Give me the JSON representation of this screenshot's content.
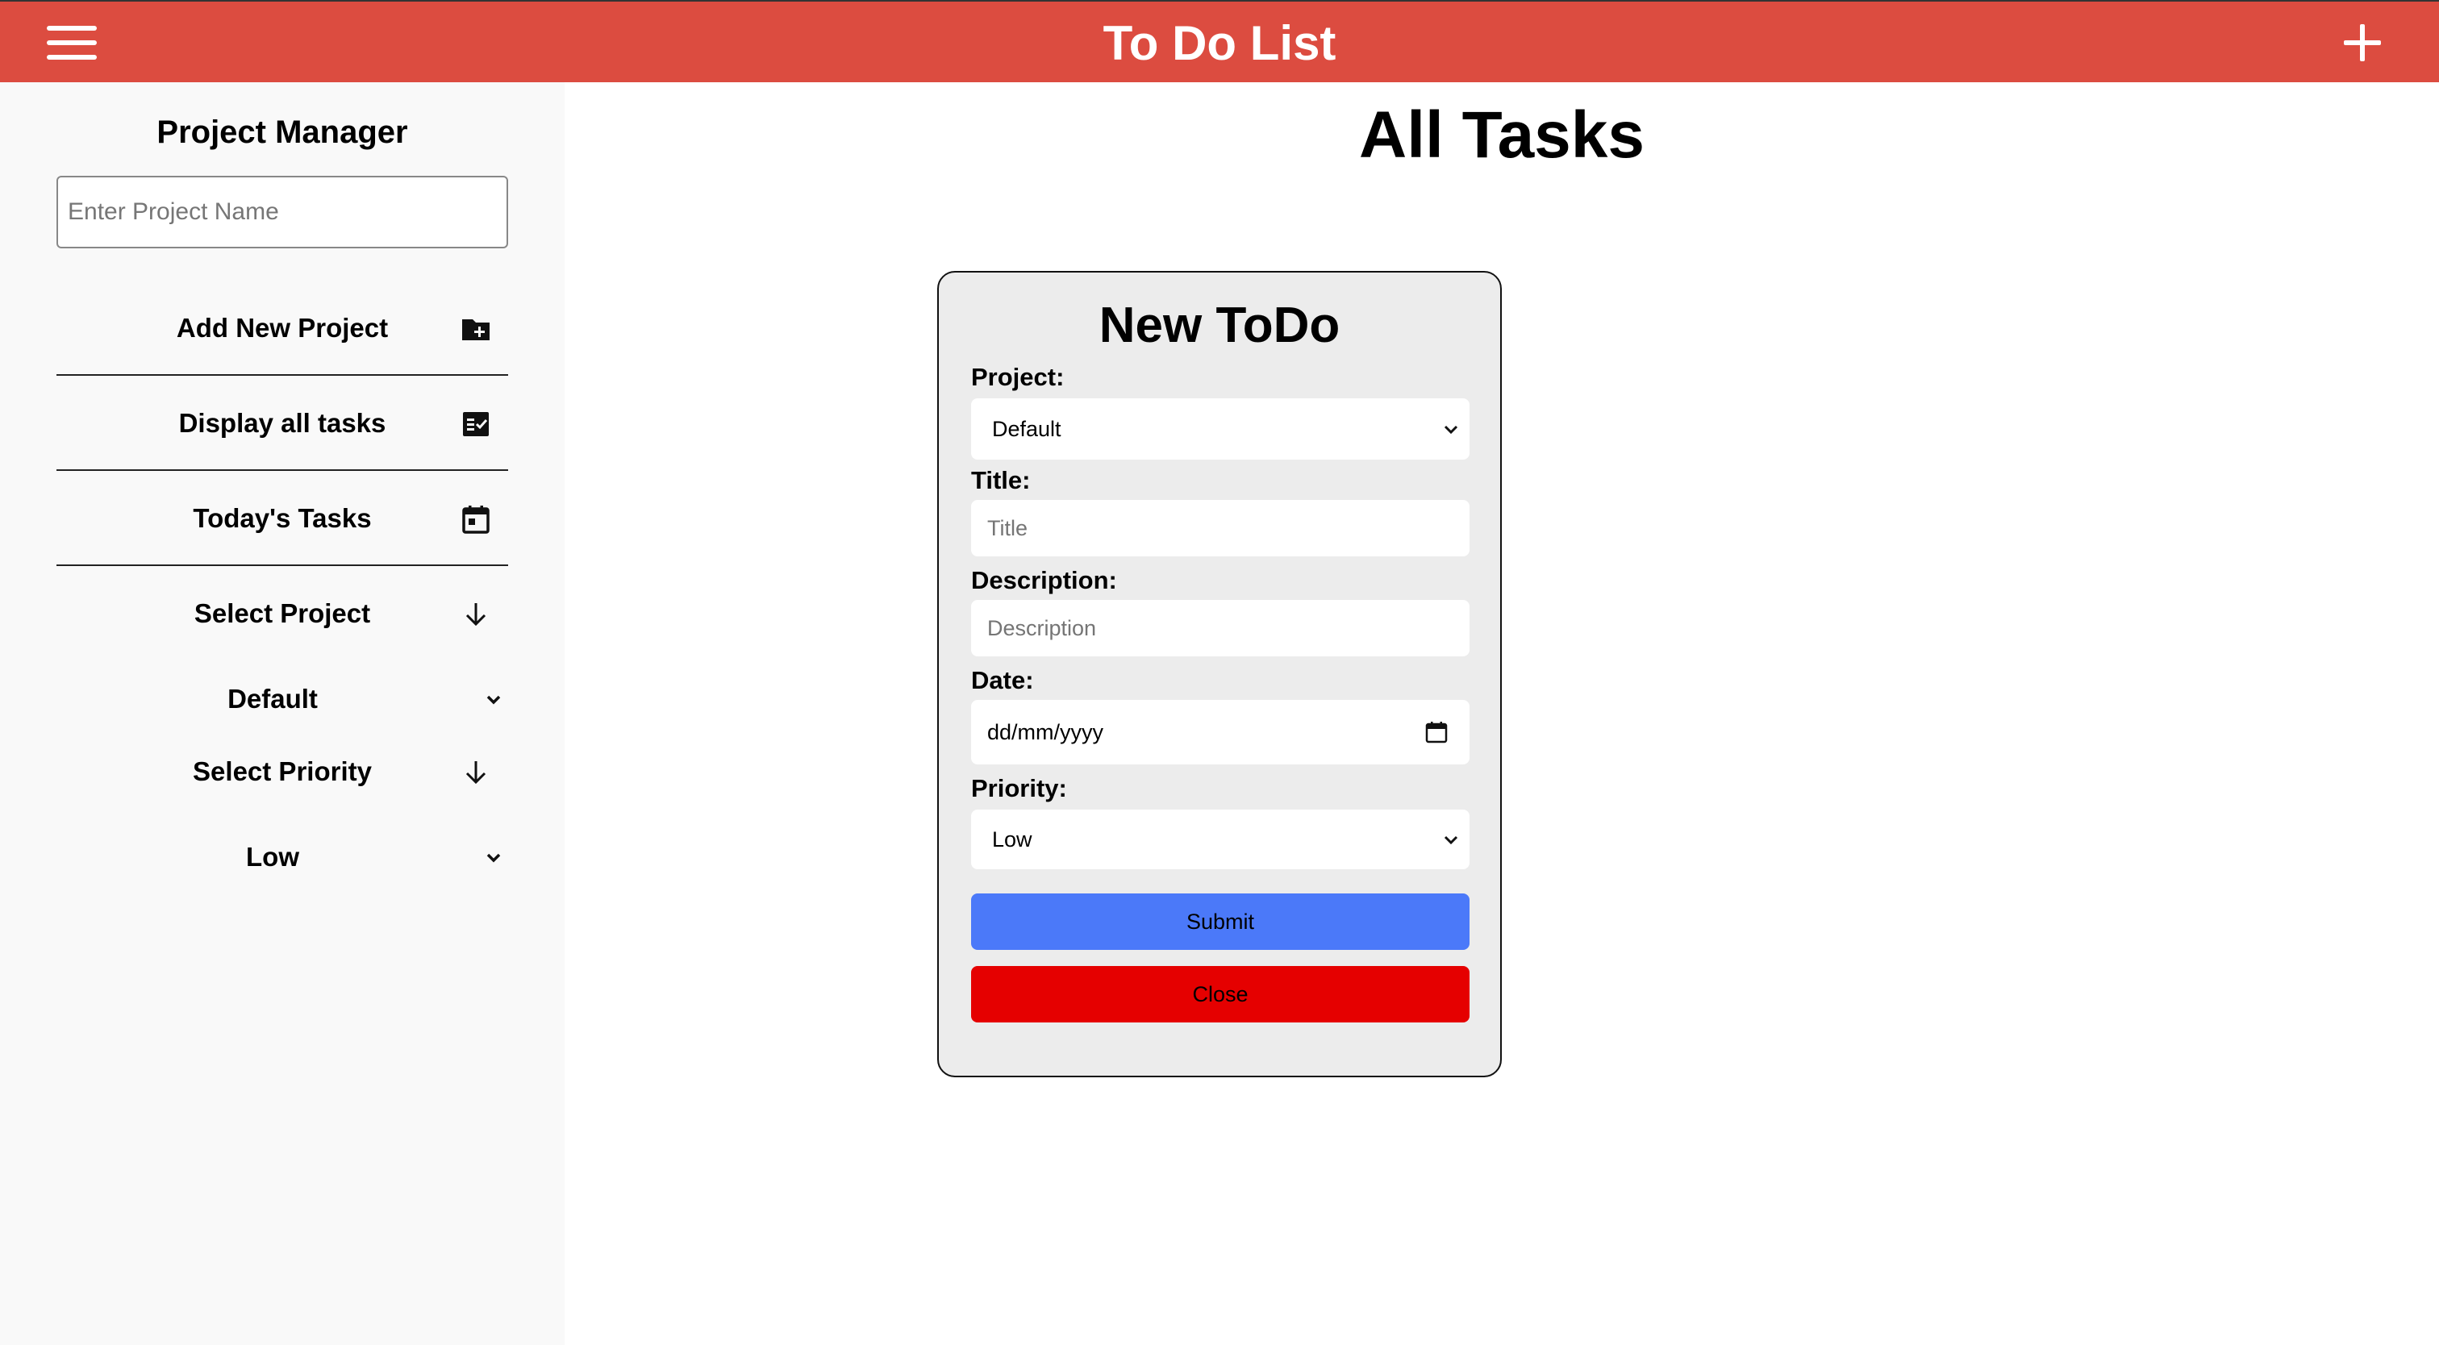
{
  "header": {
    "title": "To Do List",
    "color": "#dc4c40",
    "menu_icon": "hamburger-menu-icon",
    "add_icon": "plus-icon"
  },
  "sidebar": {
    "title": "Project Manager",
    "project_input": {
      "placeholder": "Enter Project Name",
      "value": ""
    },
    "items": [
      {
        "label": "Add New Project",
        "icon": "folder-plus-icon"
      },
      {
        "label": "Display all tasks",
        "icon": "task-list-icon"
      },
      {
        "label": "Today's Tasks",
        "icon": "calendar-icon"
      },
      {
        "label": "Select Project",
        "icon": "arrow-down-icon"
      }
    ],
    "project_select": {
      "value": "Default"
    },
    "priority_heading": {
      "label": "Select Priority",
      "icon": "arrow-down-icon"
    },
    "priority_select": {
      "value": "Low"
    }
  },
  "main": {
    "title": "All Tasks"
  },
  "modal": {
    "title": "New ToDo",
    "project": {
      "label": "Project:",
      "value": "Default"
    },
    "title_field": {
      "label": "Title:",
      "placeholder": "Title"
    },
    "description": {
      "label": "Description:",
      "placeholder": "Description"
    },
    "date": {
      "label": "Date:",
      "value": "dd/mm/yyyy"
    },
    "priority": {
      "label": "Priority:",
      "value": "Low"
    },
    "submit_label": "Submit",
    "close_label": "Close",
    "submit_color": "#4b79f9",
    "close_color": "#e50000"
  }
}
